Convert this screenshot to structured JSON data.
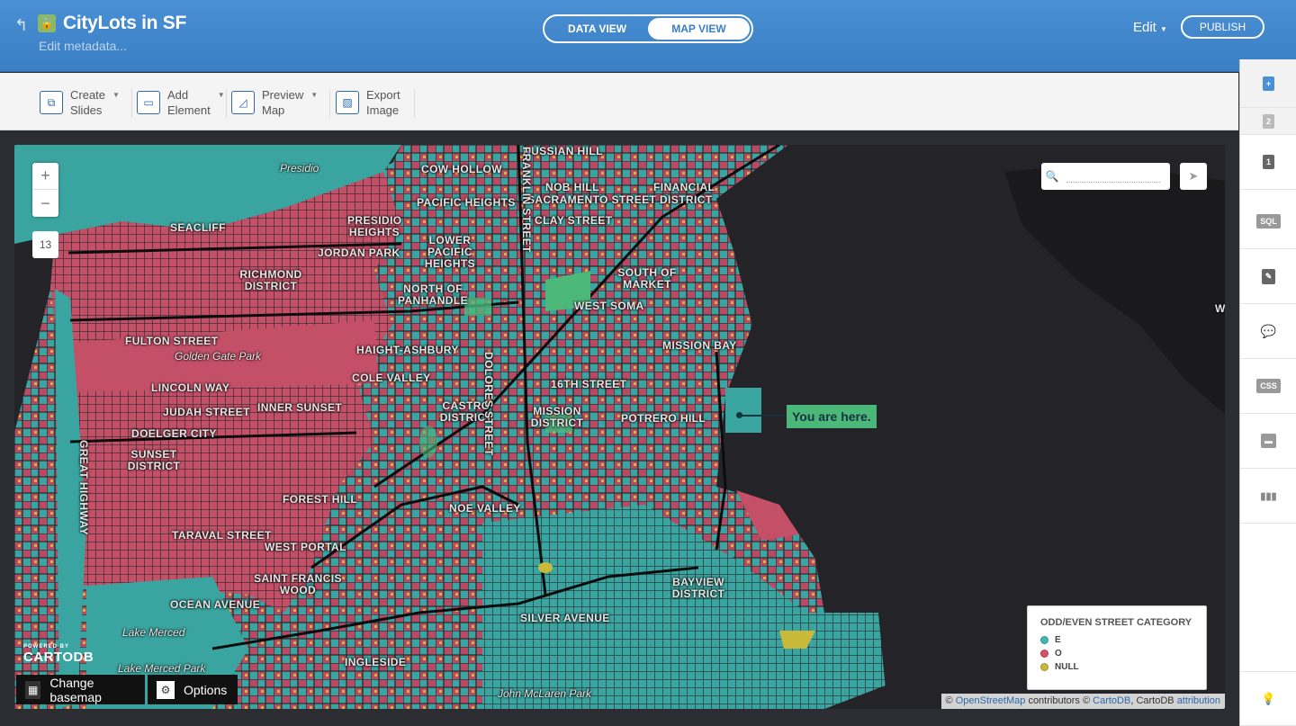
{
  "header": {
    "title": "CityLots in SF",
    "edit_metadata": "Edit metadata...",
    "data_view": "DATA VIEW",
    "map_view": "MAP VIEW",
    "edit": "Edit",
    "publish": "PUBLISH"
  },
  "toolbar": {
    "create": [
      "Create",
      "Slides"
    ],
    "add": [
      "Add",
      "Element"
    ],
    "preview": [
      "Preview",
      "Map"
    ],
    "export": [
      "Export",
      "Image"
    ]
  },
  "map": {
    "zoom_level": "13",
    "search_placeholder": "",
    "callout": "You are here.",
    "labels": {
      "presidio": "Presidio",
      "russian_hill": "RUSSIAN HILL",
      "cow_hollow": "COW HOLLOW",
      "nob_hill": "NOB HILL",
      "financial": "FINANCIAL",
      "pacific_heights": "PACIFIC HEIGHTS",
      "sacramento": "SACRAMENTO STREET DISTRICT",
      "clay_street": "CLAY STREET",
      "seacliff": "SEACLIFF",
      "presidio_heights": "PRESIDIO HEIGHTS",
      "lower_pacific": "LOWER PACIFIC HEIGHTS",
      "jordan_park": "JORDAN PARK",
      "richmond": "RICHMOND DISTRICT",
      "north_panhandle": "NORTH OF PANHANDLE",
      "south_market": "SOUTH OF MARKET",
      "west_soma": "WEST SOMA",
      "fulton": "FULTON STREET",
      "golden_gate_park": "Golden Gate Park",
      "haight": "HAIGHT-ASHBURY",
      "mission_bay": "MISSION BAY",
      "cole_valley": "COLE VALLEY",
      "lincoln_way": "LINCOLN WAY",
      "sixteenth": "16TH STREET",
      "judah": "JUDAH STREET",
      "inner_sunset": "INNER SUNSET",
      "castro": "CASTRO DISTRICT",
      "mission": "MISSION DISTRICT",
      "potrero": "POTRERO HILL",
      "doelger": "DOELGER CITY",
      "sunset": "SUNSET DISTRICT",
      "dolores": "DOLORES STREET",
      "franklin": "FRANKLIN STREET",
      "great_highway": "GREAT HIGHWAY",
      "noe_valley": "NOE VALLEY",
      "forest_hill": "FOREST HILL",
      "taraval": "TARAVAL STREET",
      "west_portal": "WEST PORTAL",
      "saint_francis": "SAINT FRANCIS WOOD",
      "bayview": "BAYVIEW DISTRICT",
      "ocean_ave": "OCEAN AVENUE",
      "silver_ave": "SILVER AVENUE",
      "lake_merced": "Lake Merced",
      "lake_merced_park": "Lake Merced Park",
      "ingleside": "INGLESIDE",
      "john_mclaren": "John McLaren Park",
      "w_edge": "W"
    }
  },
  "legend": {
    "title": "ODD/EVEN STREET CATEGORY",
    "items": [
      {
        "label": "E",
        "color": "#3fb8b4"
      },
      {
        "label": "O",
        "color": "#d9506a"
      },
      {
        "label": "NULL",
        "color": "#c9b93a"
      }
    ]
  },
  "footer": {
    "powered_by": "POWERED BY",
    "brand": "CARTODB",
    "change_basemap": "Change basemap",
    "options": "Options",
    "attribution_prefix": "©",
    "osm": "OpenStreetMap",
    "contributors": "contributors ©",
    "cartodb": "CartoDB",
    "cartodb_attr": ", CartoDB",
    "attribution": "attribution"
  },
  "sidebar": {
    "add": "+",
    "slide2": "2",
    "slide1": "1",
    "sql": "SQL",
    "wizard": "✎",
    "infowindow": "💬",
    "css": "CSS",
    "legends": "▬",
    "filters": "▮▮▮",
    "tip": "💡"
  },
  "colors": {
    "teal": "#3fb8b4",
    "red": "#d9506a",
    "yellow": "#c9b93a",
    "green": "#4bb87a",
    "header_blue": "#3a7ec4"
  }
}
